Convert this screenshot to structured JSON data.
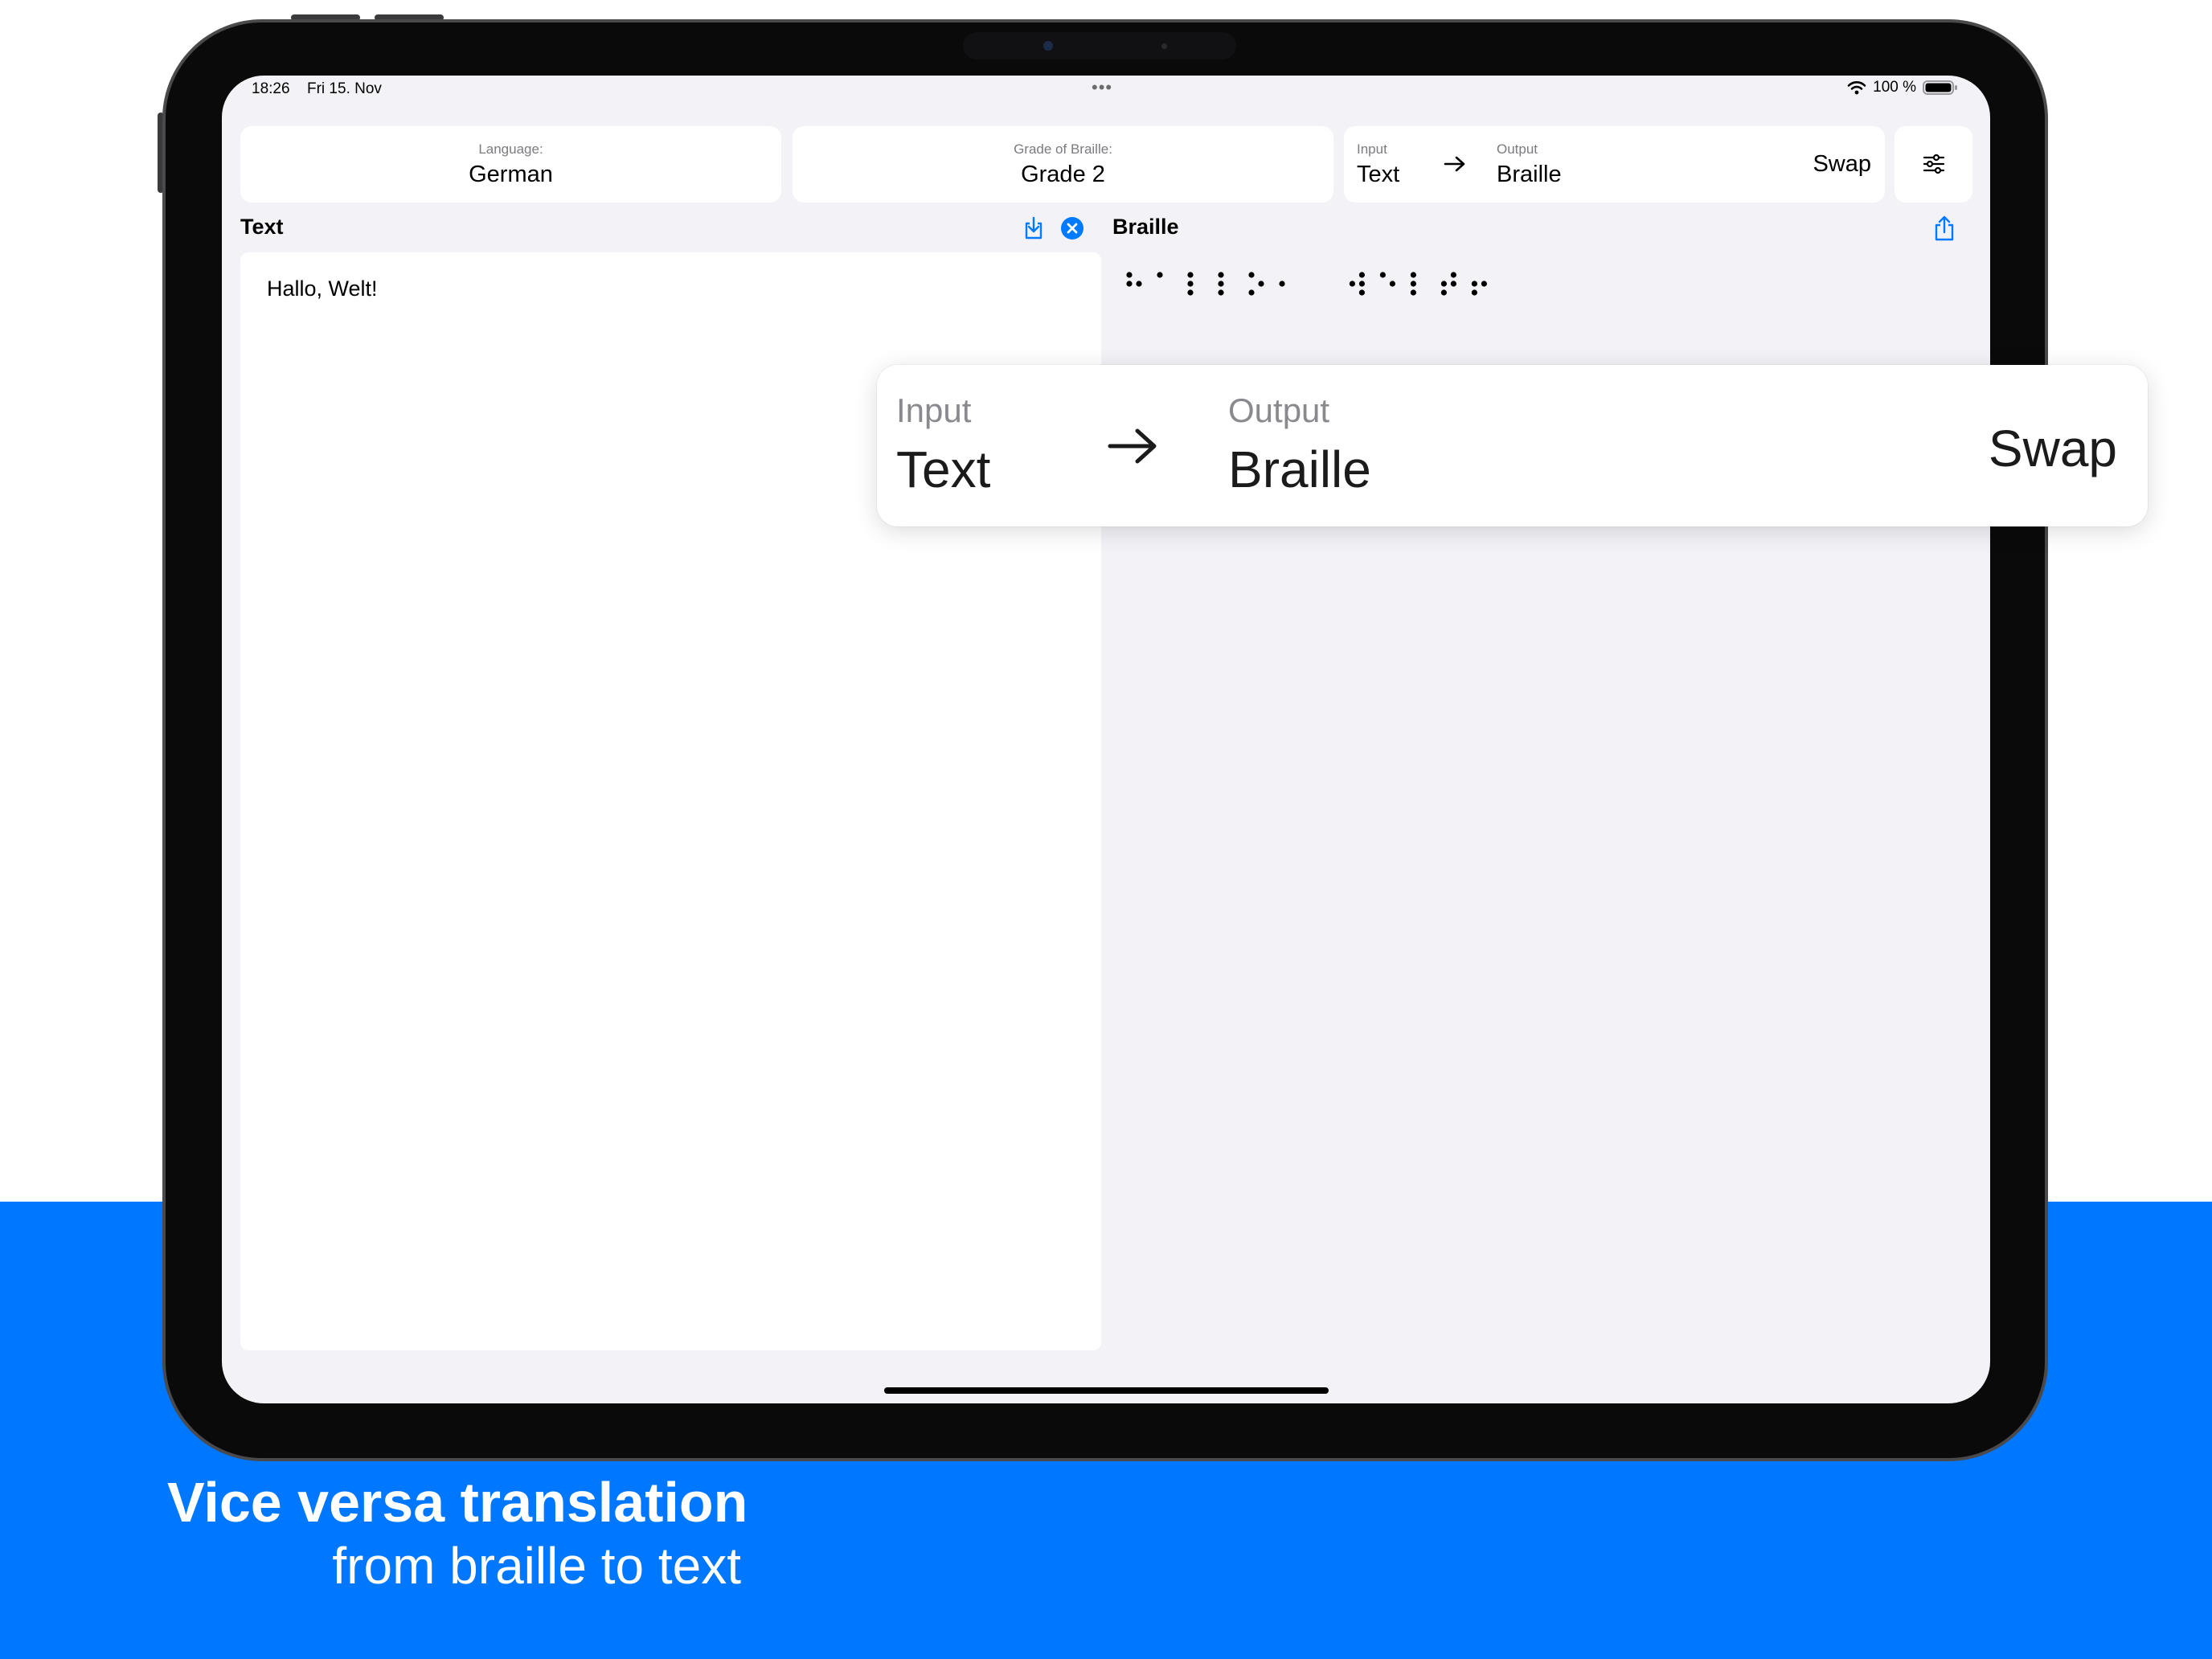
{
  "status_bar": {
    "time": "18:26",
    "date": "Fri 15. Nov",
    "battery_percent": "100 %",
    "battery_level": 1.0
  },
  "controls": {
    "language": {
      "label": "Language:",
      "value": "German"
    },
    "grade": {
      "label": "Grade of Braille:",
      "value": "Grade 2"
    },
    "io": {
      "input_label": "Input",
      "input_value": "Text",
      "output_label": "Output",
      "output_value": "Braille",
      "swap_label": "Swap"
    }
  },
  "text_panel": {
    "title": "Text",
    "value": "Hallo, Welt!"
  },
  "braille_panel": {
    "title": "Braille",
    "output": "⠓⠁⠇⠇⠕⠂ ⠺⠑⠇⠞⠖"
  },
  "callout": {
    "input_label": "Input",
    "input_value": "Text",
    "output_label": "Output",
    "output_value": "Braille",
    "swap_label": "Swap"
  },
  "caption": {
    "title": "Vice versa translation",
    "subtitle": "from braille to text"
  },
  "colors": {
    "accent": "#0077ff",
    "ios_blue": "#007aff",
    "screen_background": "#f2f2f7"
  }
}
